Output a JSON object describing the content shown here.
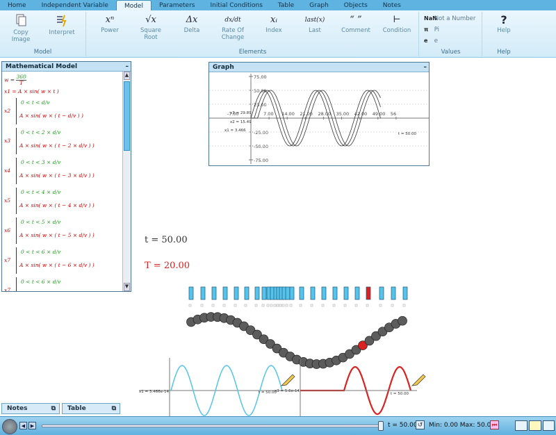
{
  "tabs": [
    "Home",
    "Independent Variable",
    "Model",
    "Parameters",
    "Initial Conditions",
    "Table",
    "Graph",
    "Objects",
    "Notes"
  ],
  "active_tab": "Model",
  "ribbon": {
    "copy_image": "Copy Image",
    "interpret": "Interpret",
    "model_group": "Model",
    "elements_group": "Elements",
    "values_group": "Values",
    "help_group": "Help",
    "elements": [
      {
        "icon": "xⁿ",
        "label": "Power"
      },
      {
        "icon": "√x",
        "label": "Square Root"
      },
      {
        "icon": "Δx",
        "label": "Delta"
      },
      {
        "icon": "dx/dt",
        "label": "Rate Of Change"
      },
      {
        "icon": "xᵢ",
        "label": "Index"
      },
      {
        "icon": "last(x)",
        "label": "Last"
      },
      {
        "icon": "“ ”",
        "label": "Comment"
      },
      {
        "icon": "⊢",
        "label": "Condition"
      }
    ],
    "values": [
      {
        "icon": "NaN",
        "label": "Not a Number"
      },
      {
        "icon": "π",
        "label": "Pi"
      },
      {
        "icon": "e",
        "label": "e"
      }
    ],
    "help_label": "Help",
    "help_icon": "?"
  },
  "model_panel": {
    "title": "Mathematical Model",
    "w_var": "w",
    "w_num": "360",
    "w_den": "T",
    "x1_line": "x1 = A × sin( w × t )",
    "eq_vars": [
      "x2",
      "x3",
      "x4",
      "x5",
      "x6",
      "x7",
      "x7"
    ],
    "cond_texts": [
      "0 < t < d/v",
      "0 < t < 2 × d/v",
      "0 < t < 3 × d/v",
      "0 < t < 4 × d/v",
      "0 < t < 5 × d/v",
      "0 < t < 6 × d/v",
      "0 < t < 6 × d/v"
    ],
    "expr_texts": [
      "A × sin( w × ( t − d/v ) )",
      "A × sin( w × ( t − 2 × d/v ) )",
      "A × sin( w × ( t − 3 × d/v ) )",
      "A × sin( w × ( t − 4 × d/v ) )",
      "A × sin( w × ( t − 5 × d/v ) )",
      "A × sin( w × ( t − 6 × d/v ) )"
    ]
  },
  "graph_panel": {
    "title": "Graph",
    "y_ticks": [
      "75.00",
      "50.00",
      "25.00",
      "-25.00",
      "-50.00",
      "-75.00"
    ],
    "x_ticks": [
      "7.00",
      "14.00",
      "21.00",
      "28.00",
      "35.00",
      "42.00",
      "49.00",
      "56"
    ],
    "x_neg_tick": "-7.00",
    "readout_x3": "x3 = 29.89",
    "readout_x2": "x2 = 15.49",
    "readout_x1": "x1 = 3.466",
    "readout_t": "t = 50.00"
  },
  "canvas": {
    "t_label": "t = 50.00",
    "T_label": "T = 20.00",
    "mini_graph_label_left": "x1 = 3.466e-14",
    "mini_graph_label_t1": "t = 50.00",
    "mini_graph_label_x2": "x3 = 5.6e-14",
    "mini_graph_label_t2": "t = 50.00",
    "colors": {
      "blue": "#54c4ea",
      "red": "#d92222",
      "ball": "#555555"
    }
  },
  "bottom_tabs": [
    "Notes",
    "Table"
  ],
  "status": {
    "t_value": "t = 50.00",
    "range": "Min: 0.00 Max: 50.00"
  }
}
